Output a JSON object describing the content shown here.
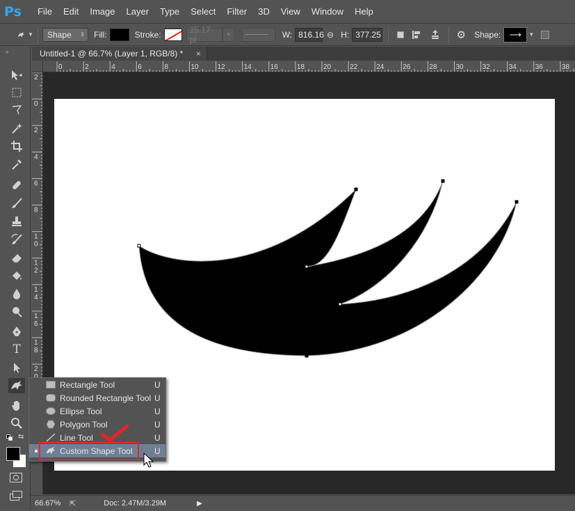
{
  "app": {
    "logo": "Ps"
  },
  "menu": [
    "File",
    "Edit",
    "Image",
    "Layer",
    "Type",
    "Select",
    "Filter",
    "3D",
    "View",
    "Window",
    "Help"
  ],
  "options": {
    "mode": "Shape",
    "fill_label": "Fill:",
    "stroke_label": "Stroke:",
    "stroke_width": "25.17 pt",
    "w_label": "W:",
    "w_value": "816.16",
    "h_label": "H:",
    "h_value": "377.25",
    "shape_label": "Shape:"
  },
  "document": {
    "tab_title": "Untitled-1 @ 66.7% (Layer 1, RGB/8) *",
    "close": "×"
  },
  "ruler_top_labels": [
    "0",
    "2",
    "4",
    "6",
    "8",
    "10",
    "12",
    "14",
    "16",
    "18",
    "20",
    "22",
    "24",
    "26",
    "28",
    "30",
    "32",
    "34",
    "36",
    "38"
  ],
  "ruler_left_labels": [
    "2",
    "0",
    "2",
    "4",
    "6",
    "8",
    "1 0",
    "1 2",
    "1 4",
    "1 6",
    "1 8",
    "2 0"
  ],
  "flyout": {
    "items": [
      {
        "label": "Rectangle Tool",
        "key": "U",
        "icon": "rectangle-icon"
      },
      {
        "label": "Rounded Rectangle Tool",
        "key": "U",
        "icon": "rounded-rectangle-icon"
      },
      {
        "label": "Ellipse Tool",
        "key": "U",
        "icon": "ellipse-icon"
      },
      {
        "label": "Polygon Tool",
        "key": "U",
        "icon": "polygon-icon"
      },
      {
        "label": "Line Tool",
        "key": "U",
        "icon": "line-icon"
      },
      {
        "label": "Custom Shape Tool",
        "key": "U",
        "icon": "custom-shape-icon"
      }
    ],
    "selected_index": 5
  },
  "status": {
    "zoom": "66.67%",
    "doc": "Doc: 2.47M/3.29M"
  },
  "colors": {
    "accent_highlight": "#e5252b",
    "selection_bg": "#6f7f93",
    "ps_blue": "#31a8ff"
  }
}
